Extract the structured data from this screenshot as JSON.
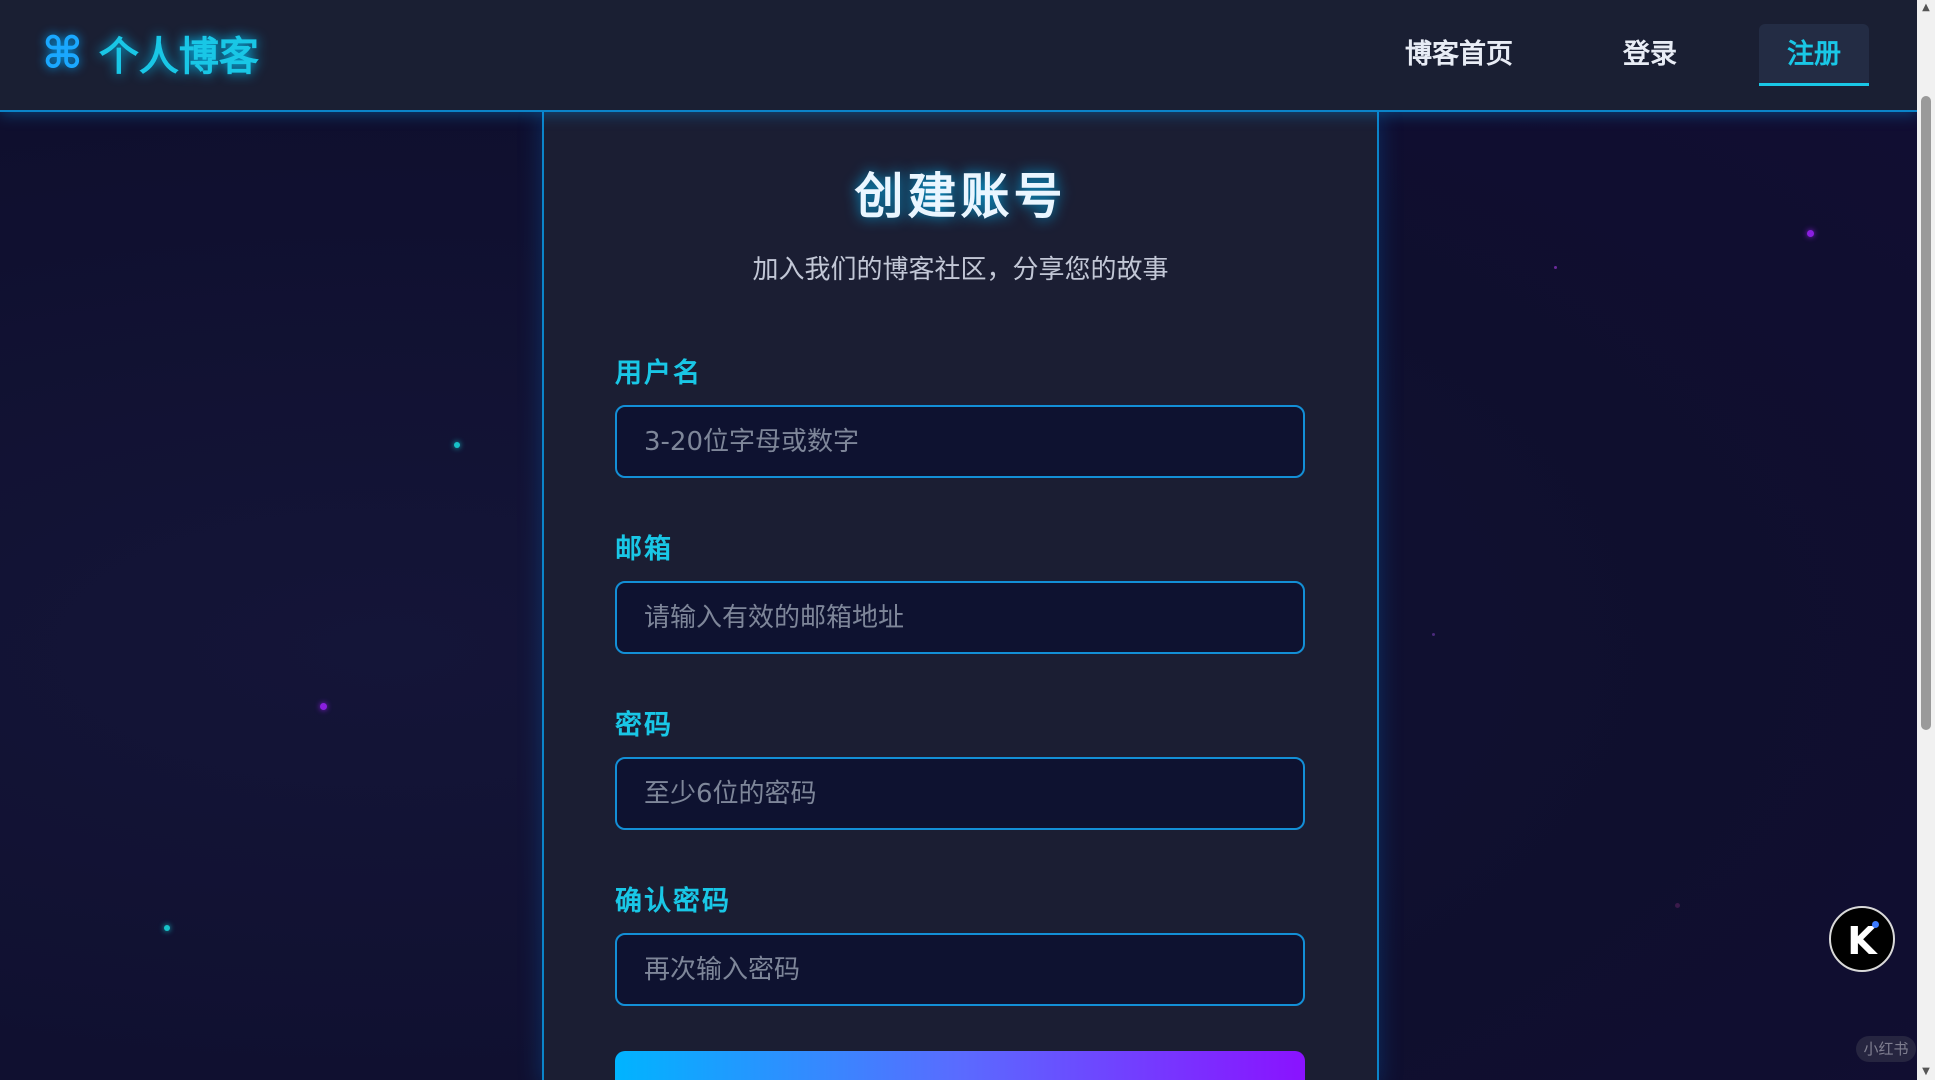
{
  "header": {
    "logo_icon": "⌘",
    "logo_text": "个人博客",
    "nav": {
      "home": "博客首页",
      "login": "登录",
      "register": "注册"
    }
  },
  "form": {
    "title": "创建账号",
    "subtitle": "加入我们的博客社区，分享您的故事",
    "fields": {
      "username": {
        "label": "用户名",
        "placeholder": "3-20位字母或数字"
      },
      "email": {
        "label": "邮箱",
        "placeholder": "请输入有效的邮箱地址"
      },
      "password": {
        "label": "密码",
        "placeholder": "至少6位的密码"
      },
      "confirm": {
        "label": "确认密码",
        "placeholder": "再次输入密码"
      }
    }
  },
  "badge": {
    "text": "K"
  },
  "watermark": {
    "text": "小红书"
  },
  "icons": {
    "logo": "command-icon",
    "scroll_up": "arrow-up-icon",
    "scroll_down": "arrow-down-icon"
  },
  "colors": {
    "accent": "#19c7e6",
    "border": "#0b84c9",
    "panel": "#1b1e33",
    "header": "#1a1f33",
    "gradient_start": "#00b4ff",
    "gradient_end": "#8a12ff"
  }
}
